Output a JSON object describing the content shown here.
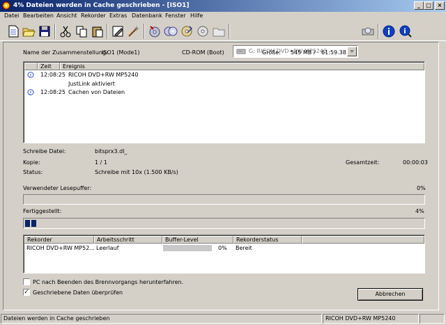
{
  "window": {
    "title": "4% Dateien werden in Cache geschrieben - [ISO1]",
    "minimize": "_",
    "maximize": "□",
    "close": "×"
  },
  "menu": [
    "Datei",
    "Bearbeiten",
    "Ansicht",
    "Rekorder",
    "Extras",
    "Datenbank",
    "Fenster",
    "Hilfe"
  ],
  "toolbar": {
    "recorder_select": "G: RICOH   DVD+RW MP5240",
    "icons": [
      "new-icon",
      "open-icon",
      "save-icon",
      "cut-icon",
      "copy-icon",
      "paste-icon",
      "edit-icon",
      "wizard-icon",
      "burn-icon",
      "cd-copy-icon",
      "cd-info-icon",
      "erase-icon",
      "folder-icon",
      "drive-icon",
      "info-icon",
      "help-icon"
    ]
  },
  "compilation": {
    "name_label": "Name der Zusammenstellung:",
    "name_value": "ISO1 (Mode1)",
    "type_value": "CD-ROM (Boot)",
    "size_label": "Größe:",
    "size_mb": "545 MB",
    "size_sep": "/",
    "size_time": "61:59.38"
  },
  "events": {
    "col_time": "Zeit",
    "col_event": "Ereignis",
    "rows": [
      {
        "time": "12:08:25",
        "event": "RICOH DVD+RW MP5240",
        "icon": "info-icon"
      },
      {
        "time": "",
        "event": "JustLink aktiviert",
        "icon": ""
      },
      {
        "time": "12:08:25",
        "event": "Cachen von Dateien",
        "icon": "info-icon"
      }
    ]
  },
  "status": {
    "write_file_label": "Schreibe Datei:",
    "write_file_value": "bitsprx3.dl_",
    "copy_label": "Kopie:",
    "copy_value": "1 / 1",
    "total_time_label": "Gesamtzeit:",
    "total_time_value": "00:00:03",
    "status_label": "Status:",
    "status_value": "Schreibe mit 10x (1.500 KB/s)"
  },
  "read_buffer": {
    "label": "Verwendeter Lesepuffer:",
    "percent_text": "0%",
    "fraction": 0.0
  },
  "completed": {
    "label": "Fertiggestellt:",
    "percent_text": "4%",
    "fraction": 0.04
  },
  "recorders": {
    "columns": [
      "Rekorder",
      "Arbeitsschritt",
      "Buffer-Level",
      "Rekorderstatus"
    ],
    "rows": [
      {
        "recorder": "RICOH DVD+RW MP52...",
        "step": "Leerlauf",
        "buffer_text": "0%",
        "buffer_fraction": 0.0,
        "status": "Bereit"
      }
    ]
  },
  "options": {
    "shutdown_label": "PC nach Beenden des Brennvorgangs herunterfahren.",
    "shutdown_checked": false,
    "verify_label": "Geschriebene Daten überprüfen",
    "verify_checked": true
  },
  "buttons": {
    "cancel": "Abbrechen"
  },
  "statusbar": {
    "message": "Dateien werden in Cache geschrieben",
    "device": "RICOH    DVD+RW MP5240"
  },
  "colors": {
    "titlebar_start": "#0a246a",
    "titlebar_end": "#a6caf0",
    "progress": "#0a246a",
    "face": "#d4d0c8"
  }
}
